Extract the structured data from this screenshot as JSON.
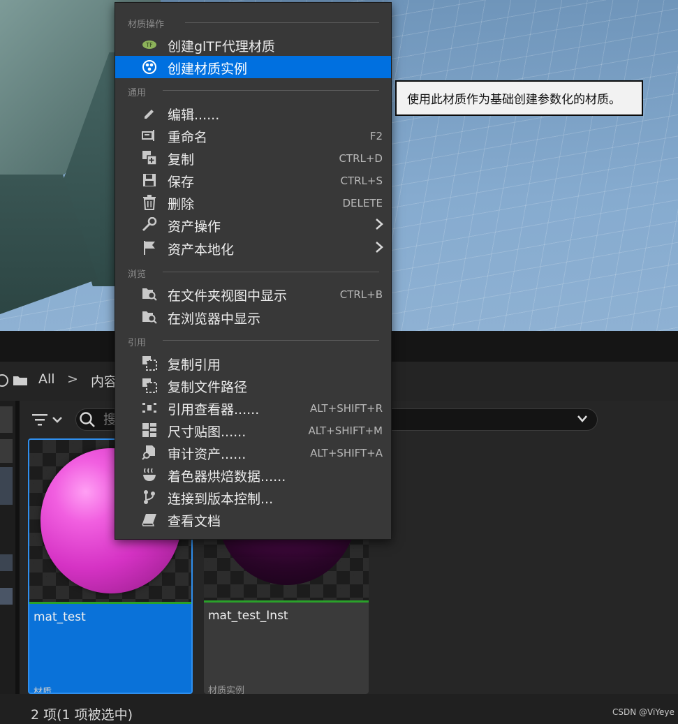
{
  "menu": {
    "sections": {
      "material_ops": "材质操作",
      "general": "通用",
      "browse": "浏览",
      "references": "引用"
    },
    "items": [
      {
        "label": "创建glTF代理材质",
        "shortcut": "",
        "icon": "gltf-icon"
      },
      {
        "label": "创建材质实例",
        "shortcut": "",
        "icon": "material-instance-icon"
      },
      {
        "label": "编辑......",
        "shortcut": "",
        "icon": "pencil-icon"
      },
      {
        "label": "重命名",
        "shortcut": "F2",
        "icon": "rename-icon"
      },
      {
        "label": "复制",
        "shortcut": "CTRL+D",
        "icon": "duplicate-icon"
      },
      {
        "label": "保存",
        "shortcut": "CTRL+S",
        "icon": "save-icon"
      },
      {
        "label": "删除",
        "shortcut": "DELETE",
        "icon": "trash-icon"
      },
      {
        "label": "资产操作",
        "shortcut": "",
        "icon": "wrench-icon"
      },
      {
        "label": "资产本地化",
        "shortcut": "",
        "icon": "flag-icon"
      },
      {
        "label": "在文件夹视图中显示",
        "shortcut": "CTRL+B",
        "icon": "folder-search-icon"
      },
      {
        "label": "在浏览器中显示",
        "shortcut": "",
        "icon": "folder-search-icon"
      },
      {
        "label": "复制引用",
        "shortcut": "",
        "icon": "copy-reference-icon"
      },
      {
        "label": "复制文件路径",
        "shortcut": "",
        "icon": "copy-path-icon"
      },
      {
        "label": "引用查看器......",
        "shortcut": "ALT+SHIFT+R",
        "icon": "reference-viewer-icon"
      },
      {
        "label": "尺寸贴图......",
        "shortcut": "ALT+SHIFT+M",
        "icon": "size-map-icon"
      },
      {
        "label": "审计资产......",
        "shortcut": "ALT+SHIFT+A",
        "icon": "audit-icon"
      },
      {
        "label": "着色器烘焙数据......",
        "shortcut": "",
        "icon": "shader-cook-icon"
      },
      {
        "label": "连接到版本控制...",
        "shortcut": "",
        "icon": "source-control-icon"
      },
      {
        "label": "查看文档",
        "shortcut": "",
        "icon": "documentation-icon"
      }
    ]
  },
  "tooltip": "使用此材质作为基础创建参数化的材质。",
  "path": {
    "root": "All",
    "separator": ">",
    "content": "内容"
  },
  "search": {
    "placeholder": "搜"
  },
  "assets": [
    {
      "name": "mat_test",
      "type": "材质",
      "selected": true
    },
    {
      "name": "mat_test_Inst",
      "type": "材质实例",
      "selected": false
    }
  ],
  "status": "2 项(1 项被选中)",
  "watermark": "CSDN @ViYeye",
  "colors": {
    "highlight": "#0070e0",
    "menu_bg": "#383838",
    "asset_bar": "#2aa12a"
  }
}
